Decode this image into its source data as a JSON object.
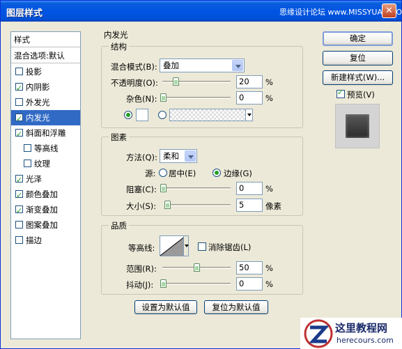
{
  "window": {
    "title": "图层样式",
    "watermark": "思缘设计论坛 www.MISSYUAN.COM"
  },
  "sidebar": {
    "header": "样式",
    "blend_options": "混合选项:默认",
    "items": [
      {
        "label": "投影",
        "checked": false,
        "indent": false
      },
      {
        "label": "内阴影",
        "checked": true,
        "indent": false
      },
      {
        "label": "外发光",
        "checked": false,
        "indent": false
      },
      {
        "label": "内发光",
        "checked": true,
        "indent": false,
        "selected": true
      },
      {
        "label": "斜面和浮雕",
        "checked": true,
        "indent": false
      },
      {
        "label": "等高线",
        "checked": false,
        "indent": true
      },
      {
        "label": "纹理",
        "checked": false,
        "indent": true
      },
      {
        "label": "光泽",
        "checked": true,
        "indent": false
      },
      {
        "label": "颜色叠加",
        "checked": true,
        "indent": false
      },
      {
        "label": "渐变叠加",
        "checked": true,
        "indent": false
      },
      {
        "label": "图案叠加",
        "checked": false,
        "indent": false
      },
      {
        "label": "描边",
        "checked": false,
        "indent": false
      }
    ]
  },
  "panel": {
    "title": "内发光",
    "structure": {
      "title": "结构",
      "blend_mode_label": "混合模式(B):",
      "blend_mode_value": "叠加",
      "opacity_label": "不透明度(O):",
      "opacity_value": "20",
      "opacity_unit": "%",
      "opacity_level": 20,
      "noise_label": "杂色(N):",
      "noise_value": "0",
      "noise_unit": "%",
      "noise_level": 0
    },
    "elements": {
      "title": "图素",
      "method_label": "方法(Q):",
      "method_value": "柔和",
      "source_label": "源:",
      "source_center": "居中(E)",
      "source_edge": "边缘(G)",
      "choke_label": "阻塞(C):",
      "choke_value": "0",
      "choke_unit": "%",
      "size_label": "大小(S):",
      "size_value": "5",
      "size_unit": "像素"
    },
    "quality": {
      "title": "品质",
      "contour_label": "等高线:",
      "antialias_label": "消除锯齿(L)",
      "range_label": "范围(R):",
      "range_value": "50",
      "range_unit": "%",
      "range_level": 50,
      "jitter_label": "抖动(J):",
      "jitter_value": "0",
      "jitter_unit": "%"
    },
    "make_default": "设置为默认值",
    "reset_default": "复位为默认值"
  },
  "buttons": {
    "ok": "确定",
    "reset": "复位",
    "new_style": "新建样式(W)...",
    "preview": "预览(V)"
  },
  "logo": {
    "main": "这里教程网",
    "sub": "herecours.com"
  }
}
